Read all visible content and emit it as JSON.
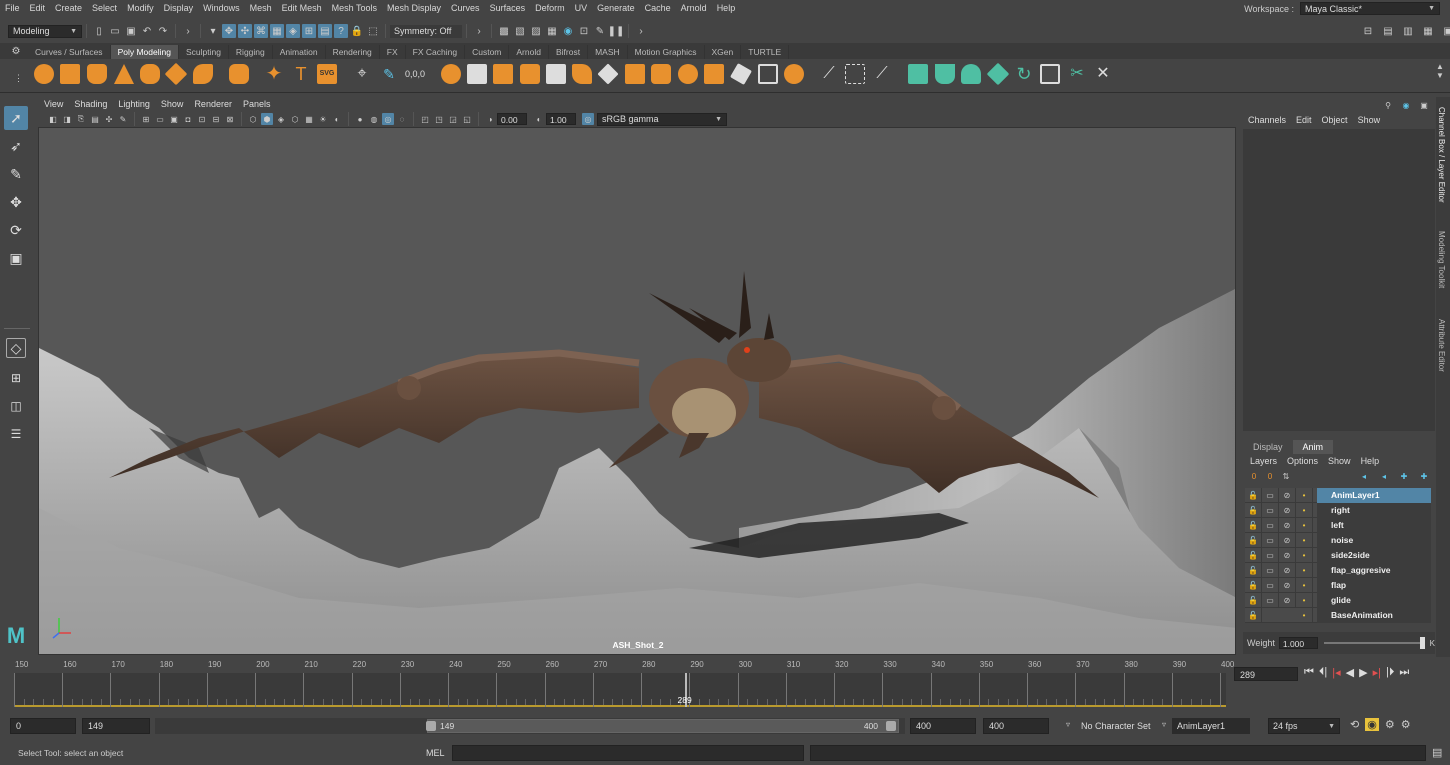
{
  "menubar": {
    "items": [
      "File",
      "Edit",
      "Create",
      "Select",
      "Modify",
      "Display",
      "Windows",
      "Mesh",
      "Edit Mesh",
      "Mesh Tools",
      "Mesh Display",
      "Curves",
      "Surfaces",
      "Deform",
      "UV",
      "Generate",
      "Cache",
      "Arnold",
      "Help"
    ],
    "workspace_label": "Workspace :",
    "workspace_value": "Maya Classic*"
  },
  "statusline": {
    "mode": "Modeling",
    "symmetry": "Symmetry: Off"
  },
  "shelf": {
    "tabs": [
      "Curves / Surfaces",
      "Poly Modeling",
      "Sculpting",
      "Rigging",
      "Animation",
      "Rendering",
      "FX",
      "FX Caching",
      "Custom",
      "Arnold",
      "Bifrost",
      "MASH",
      "Motion Graphics",
      "XGen",
      "TURTLE"
    ],
    "active_tab": "Poly Modeling",
    "colors": {
      "orange": "#e8912e",
      "teal": "#4fbfa3",
      "white": "#dddddd"
    }
  },
  "viewport": {
    "menus": [
      "View",
      "Shading",
      "Lighting",
      "Show",
      "Renderer",
      "Panels"
    ],
    "exposure": "0.00",
    "gamma": "1.00",
    "color_space": "sRGB gamma",
    "camera_label": "ASH_Shot_2",
    "background": "#575757"
  },
  "channelbox": {
    "menus": [
      "Channels",
      "Edit",
      "Object",
      "Show"
    ]
  },
  "side_tabs": [
    "Channel Box / Layer Editor",
    "Modeling Toolkit",
    "Attribute Editor"
  ],
  "layer_editor": {
    "tabs": [
      "Display",
      "Anim"
    ],
    "active_tab": "Anim",
    "menus": [
      "Layers",
      "Options",
      "Show",
      "Help"
    ],
    "layers": [
      "AnimLayer1",
      "right",
      "left",
      "noise",
      "side2side",
      "flap_aggresive",
      "flap",
      "glide",
      "BaseAnimation"
    ],
    "selected_layer": "AnimLayer1",
    "weight_label": "Weight",
    "weight_value": "1.000",
    "k_label": "K"
  },
  "timeline": {
    "ticks": [
      "150",
      "160",
      "170",
      "180",
      "190",
      "200",
      "210",
      "220",
      "230",
      "240",
      "250",
      "260",
      "270",
      "280",
      "290",
      "300",
      "310",
      "320",
      "330",
      "340",
      "350",
      "360",
      "370",
      "380",
      "390",
      "400"
    ],
    "current_frame": "289",
    "current_frame_field": "289",
    "start": 150,
    "end": 400,
    "current": 289
  },
  "range": {
    "start_field": "0",
    "playback_start": "149",
    "slider_start": "149",
    "slider_end": "400",
    "playback_end": "400",
    "end_field": "400",
    "character_set": "No Character Set",
    "anim_layer": "AnimLayer1",
    "fps": "24 fps"
  },
  "cmdline": {
    "help_text": "Select Tool: select an object",
    "lang": "MEL"
  }
}
